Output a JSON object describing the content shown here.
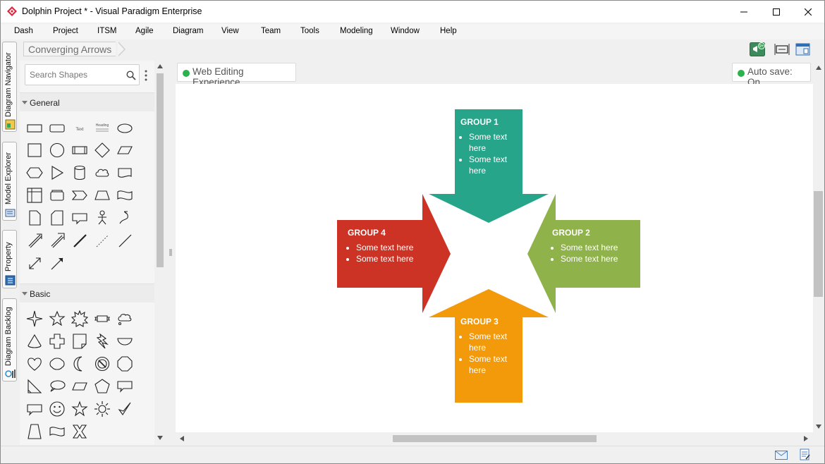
{
  "window": {
    "title": "Dolphin Project * - Visual Paradigm Enterprise",
    "controls": [
      "minimize",
      "maximize",
      "close"
    ]
  },
  "menu": [
    "Dash",
    "Project",
    "ITSM",
    "Agile",
    "Diagram",
    "View",
    "Team",
    "Tools",
    "Modeling",
    "Window",
    "Help"
  ],
  "side_tabs": [
    "Diagram Navigator",
    "Model Explorer",
    "Property",
    "Diagram Backlog"
  ],
  "breadcrumb": "Converging Arrows",
  "shapes_panel": {
    "search_placeholder": "Search Shapes",
    "sections": [
      {
        "label": "General"
      },
      {
        "label": "Basic"
      }
    ],
    "general_text_item": "Text",
    "general_heading_item": "Heading"
  },
  "diagram_header": {
    "web_editing": "Web Editing Experience",
    "auto_save": "Auto save: On",
    "notification_badge": "9+"
  },
  "diagram": {
    "groups": [
      {
        "title": "GROUP 1",
        "color": "#27a58a",
        "items": [
          "Some text here",
          "Some text here"
        ]
      },
      {
        "title": "GROUP 2",
        "color": "#8fb34a",
        "items": [
          "Some text here",
          "Some text here"
        ]
      },
      {
        "title": "GROUP 3",
        "color": "#f39a0b",
        "items": [
          "Some text here",
          "Some text here"
        ]
      },
      {
        "title": "GROUP 4",
        "color": "#cc3324",
        "items": [
          "Some text here",
          "Some text here"
        ]
      }
    ]
  },
  "colors": {
    "status_green": "#2bb24c"
  }
}
